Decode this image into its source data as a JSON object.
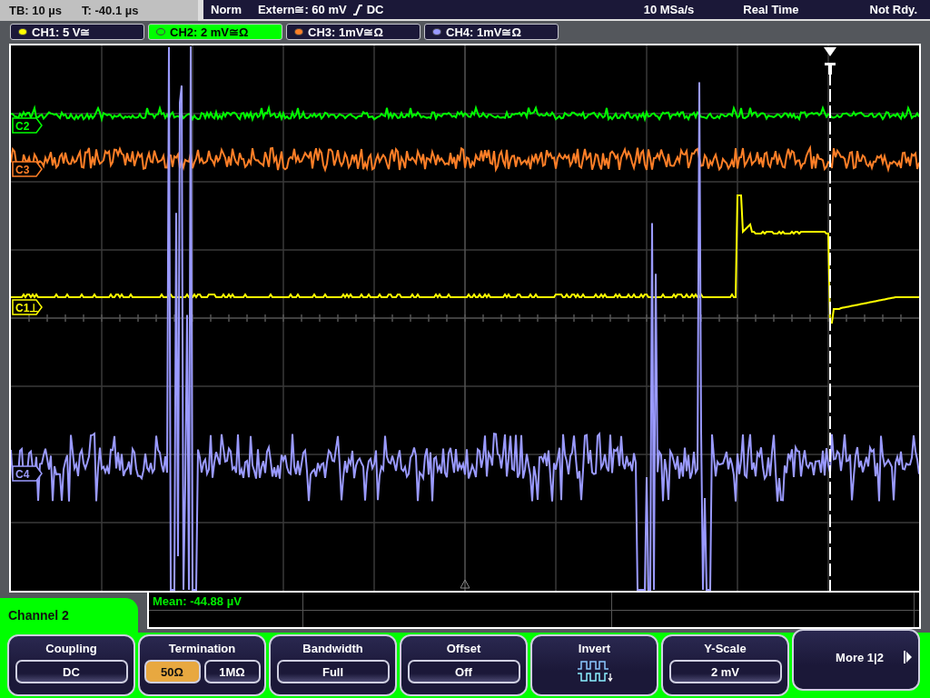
{
  "status_bar": {
    "timebase": "TB: 10 µs",
    "trigger_time": "T: -40.1 µs",
    "mode": "Norm",
    "trigger_source": "Extern≅: 60 mV",
    "trigger_coupling": "DC",
    "sample_rate": "10 MSa/s",
    "acquisition": "Real Time",
    "state": "Not Rdy."
  },
  "channels": [
    {
      "label": "CH1: 5 V≅",
      "color": "#ffff00",
      "selected": false
    },
    {
      "label": "CH2: 2 mV≅Ω",
      "color": "#00ff00",
      "selected": true
    },
    {
      "label": "CH3: 1mV≅Ω",
      "color": "#ff7f27",
      "selected": false
    },
    {
      "label": "CH4: 1mV≅Ω",
      "color": "#9a9aff",
      "selected": false
    }
  ],
  "trace_markers": [
    {
      "label": "C2",
      "color": "#00ff00"
    },
    {
      "label": "C3",
      "color": "#ff7f27"
    },
    {
      "label": "C1⊥",
      "color": "#ffff00"
    },
    {
      "label": "C4",
      "color": "#9a9aff"
    }
  ],
  "measurement": "Mean: -44.88 µV",
  "menu_title": "Channel 2",
  "softkeys": [
    {
      "kind": "value",
      "title": "Coupling",
      "value": "DC"
    },
    {
      "kind": "toggle",
      "title": "Termination",
      "options": [
        {
          "label": "50Ω",
          "selected": true
        },
        {
          "label": "1MΩ",
          "selected": false
        }
      ]
    },
    {
      "kind": "value",
      "title": "Bandwidth",
      "value": "Full"
    },
    {
      "kind": "value",
      "title": "Offset",
      "value": "Off"
    },
    {
      "kind": "icon",
      "title": "Invert"
    },
    {
      "kind": "value",
      "title": "Y-Scale",
      "value": "2 mV"
    },
    {
      "kind": "more",
      "title": "More 1|2"
    }
  ]
}
